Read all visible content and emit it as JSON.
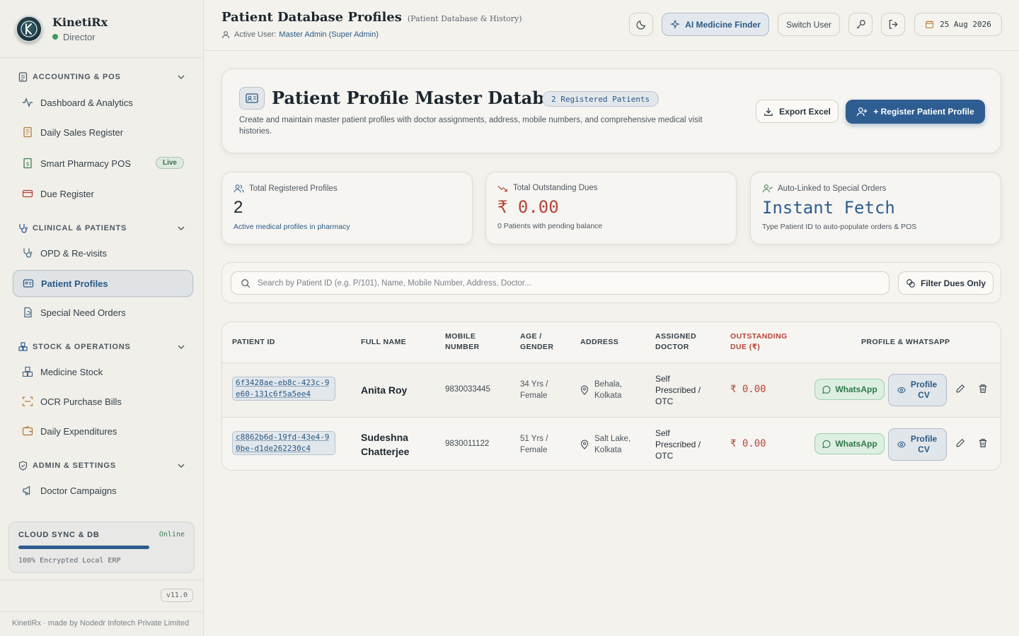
{
  "brand": {
    "name": "KinetiRx",
    "role": "Director",
    "logo_text": "KinetiRx"
  },
  "sidebar": {
    "sections": [
      {
        "title": "ACCOUNTING & POS",
        "items": [
          {
            "label": "Dashboard & Analytics",
            "icon": "activity-icon"
          },
          {
            "label": "Daily Sales Register",
            "icon": "receipt-icon"
          },
          {
            "label": "Smart Pharmacy POS",
            "icon": "cash-register-icon",
            "badge": "Live"
          },
          {
            "label": "Due Register",
            "icon": "credit-card-icon"
          }
        ]
      },
      {
        "title": "CLINICAL & PATIENTS",
        "items": [
          {
            "label": "OPD & Re-visits",
            "icon": "stethoscope-icon"
          },
          {
            "label": "Patient Profiles",
            "icon": "id-card-icon",
            "active": true
          },
          {
            "label": "Special Need Orders",
            "icon": "file-refresh-icon"
          }
        ]
      },
      {
        "title": "STOCK & OPERATIONS",
        "items": [
          {
            "label": "Medicine Stock",
            "icon": "boxes-icon"
          },
          {
            "label": "OCR Purchase Bills",
            "icon": "scan-icon"
          },
          {
            "label": "Daily Expenditures",
            "icon": "wallet-icon"
          }
        ]
      },
      {
        "title": "ADMIN & SETTINGS",
        "items": [
          {
            "label": "Doctor Campaigns",
            "icon": "megaphone-icon"
          }
        ]
      }
    ],
    "sync": {
      "title": "CLOUD SYNC & DB",
      "status": "Online",
      "progress_fraction": 0.78,
      "subtitle": "100% Encrypted Local ERP"
    },
    "version": "v11.0",
    "footer": "KinetiRx · made by Nodedr Infotech Private Limited"
  },
  "header": {
    "title": "Patient Database Profiles",
    "subtitle": "(Patient Database & History)",
    "active_user_label": "Active User:",
    "active_user": "Master Admin (Super Admin)",
    "ai_button": "AI Medicine Finder",
    "switch_user": "Switch User",
    "date": "25 Aug 2026"
  },
  "hero": {
    "title": "Patient Profile Master Database",
    "badge": "2 Registered Patients",
    "description": "Create and maintain master patient profiles with doctor assignments, address, mobile numbers, and comprehensive medical visit histories.",
    "export_label": "Export Excel",
    "register_label": "+ Register Patient Profile"
  },
  "stats": [
    {
      "label": "Total Registered Profiles",
      "value": "2",
      "foot": "Active medical profiles in pharmacy"
    },
    {
      "label": "Total Outstanding Dues",
      "value": "₹ 0.00",
      "foot": "0 Patients with pending balance"
    },
    {
      "label": "Auto-Linked to Special Orders",
      "value": "Instant Fetch",
      "foot": "Type Patient ID to auto-populate orders & POS"
    }
  ],
  "search": {
    "placeholder": "Search by Patient ID (e.g. P/101), Name, Mobile Number, Address, Doctor...",
    "filter_label": "Filter Dues Only"
  },
  "table": {
    "headers": [
      "PATIENT ID",
      "FULL NAME",
      "MOBILE NUMBER",
      "AGE / GENDER",
      "ADDRESS",
      "ASSIGNED DOCTOR",
      "OUTSTANDING DUE (₹)",
      "PROFILE & WHATSAPP"
    ],
    "rows": [
      {
        "id": "6f3428ae-eb8c-423c-9e60-131c6f5a5ee4",
        "name": "Anita Roy",
        "mobile": "9830033445",
        "age_gender": "34 Yrs / Female",
        "address": "Behala, Kolkata",
        "doctor": "Self Prescribed / OTC",
        "due": "₹ 0.00",
        "whatsapp": "WhatsApp",
        "profile": "Profile CV"
      },
      {
        "id": "c8862b6d-19fd-43e4-90be-d1de262230c4",
        "name": "Sudeshna Chatterjee",
        "mobile": "9830011122",
        "age_gender": "51 Yrs / Female",
        "address": "Salt Lake, Kolkata",
        "doctor": "Self Prescribed / OTC",
        "due": "₹ 0.00",
        "whatsapp": "WhatsApp",
        "profile": "Profile CV"
      }
    ]
  },
  "colors": {
    "accent": "#2e5d91",
    "danger": "#b5453a",
    "success": "#3e9a5f",
    "background": "#f4f2ec"
  }
}
